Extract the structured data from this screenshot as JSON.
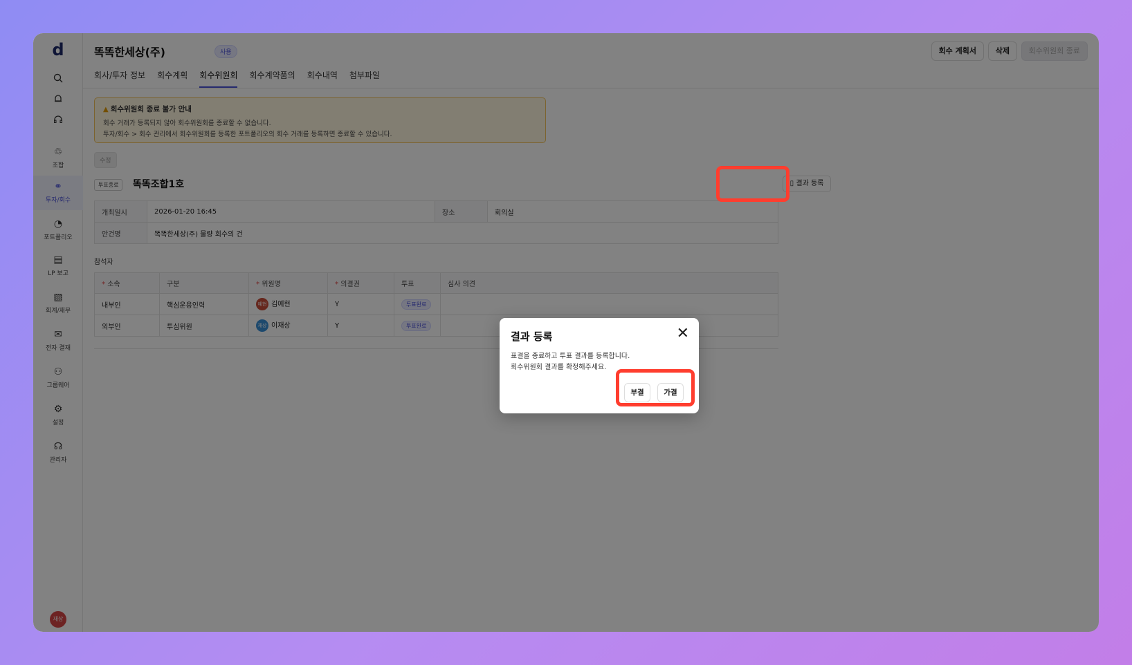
{
  "app": {
    "logo": "d"
  },
  "sidebar": {
    "search_icon": "search-icon",
    "bell_icon": "bell-icon",
    "headset_icon": "headset-icon",
    "items": [
      {
        "icon": "♲",
        "label": "조합"
      },
      {
        "icon": "⚭",
        "label": "투자/회수",
        "active": true
      },
      {
        "icon": "◔",
        "label": "포트폴리오"
      },
      {
        "icon": "▤",
        "label": "LP 보고"
      },
      {
        "icon": "▧",
        "label": "회계/재무"
      },
      {
        "icon": "✉",
        "label": "전자 결재"
      },
      {
        "icon": "⚇",
        "label": "그룹웨어"
      },
      {
        "icon": "⚙",
        "label": "설정"
      },
      {
        "icon": "☊",
        "label": "관리자"
      }
    ],
    "user_avatar": "재상"
  },
  "header": {
    "company": "똑똑한세상(주)",
    "status": "사용",
    "buttons": {
      "plan": "회수 계획서",
      "delete": "삭제",
      "end": "회수위원회 종료"
    },
    "tabs": [
      "회사/투자 정보",
      "회수계획",
      "회수위원회",
      "회수계약품의",
      "회수내역",
      "첨부파일"
    ]
  },
  "warning": {
    "title": "회수위원회 종료 불가 안내",
    "line1": "회수 거래가 등록되지 않아 회수위원회를 종료할 수 없습니다.",
    "line2": "투자/회수 > 회수 관리에서 회수위원회를 등록한 포트폴리오의 회수 거래를 등록하면 종료할 수 있습니다."
  },
  "edit_label": "수정",
  "vote_tag": "투표종료",
  "fund_name": "똑똑조합1호",
  "result_button": "결과 등록",
  "info": {
    "date_key": "개최일시",
    "date_value": "2026-01-20 16:45",
    "place_key": "장소",
    "place_value": "회의실",
    "agenda_key": "안건명",
    "agenda_value": "똑똑한세상(주) 물량 회수의 건"
  },
  "attendees": {
    "label": "참석자",
    "headers": [
      "소속",
      "구분",
      "위원명",
      "의결권",
      "투표",
      "심사 의견"
    ],
    "rows": [
      {
        "affiliation": "내부인",
        "type": "핵심운용인력",
        "avatar": "예현",
        "name": "김예현",
        "vote_right": "Y",
        "vote": "투표완료"
      },
      {
        "affiliation": "외부인",
        "type": "투심위원",
        "avatar": "재상",
        "name": "이재상",
        "vote_right": "Y",
        "vote": "투표완료"
      }
    ]
  },
  "modal": {
    "title": "결과 등록",
    "line1": "표결을 종료하고 투표 결과를 등록합니다.",
    "line2": "회수위원회 결과를 확정해주세요.",
    "reject": "부결",
    "approve": "가결"
  },
  "colors": {
    "accent": "#4a51d8",
    "highlight": "#ff3d2e",
    "warning_bg": "#fff7e0"
  }
}
